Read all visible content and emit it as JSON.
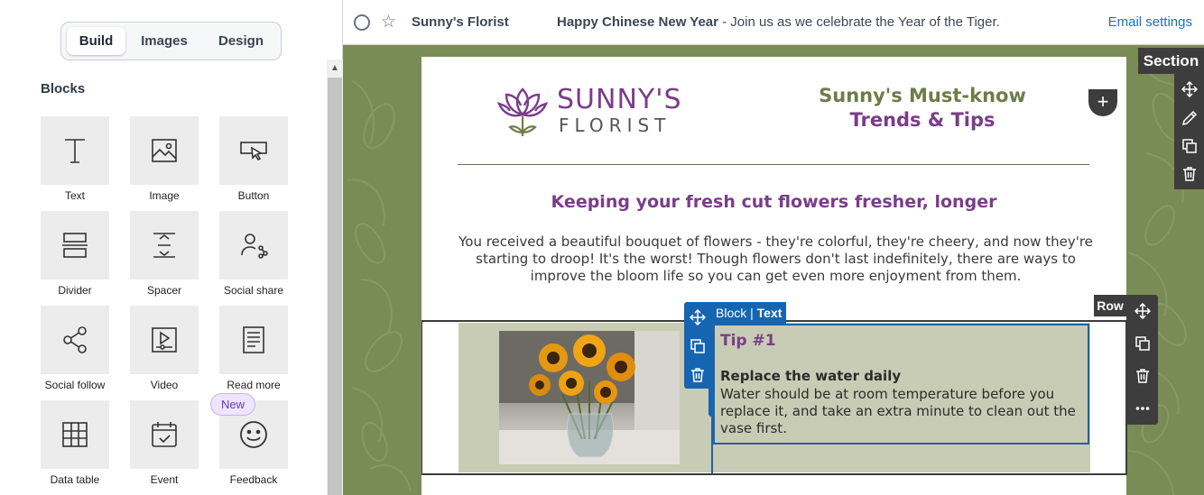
{
  "sidebar": {
    "tabs": [
      {
        "label": "Build",
        "active": true
      },
      {
        "label": "Images",
        "active": false
      },
      {
        "label": "Design",
        "active": false
      }
    ],
    "blocks_heading": "Blocks",
    "blocks": [
      {
        "label": "Text",
        "icon": "text-icon"
      },
      {
        "label": "Image",
        "icon": "image-icon"
      },
      {
        "label": "Button",
        "icon": "button-icon"
      },
      {
        "label": "Divider",
        "icon": "divider-icon"
      },
      {
        "label": "Spacer",
        "icon": "spacer-icon"
      },
      {
        "label": "Social share",
        "icon": "social-share-icon"
      },
      {
        "label": "Social follow",
        "icon": "social-follow-icon"
      },
      {
        "label": "Video",
        "icon": "video-icon"
      },
      {
        "label": "Read more",
        "icon": "read-more-icon"
      },
      {
        "label": "Data table",
        "icon": "data-table-icon"
      },
      {
        "label": "Event",
        "icon": "event-icon"
      },
      {
        "label": "Feedback",
        "icon": "feedback-icon"
      }
    ],
    "new_badge": "New"
  },
  "topbar": {
    "sender": "Sunny's Florist",
    "subject_bold": "Happy Chinese New Year",
    "subject_rest": " - Join us as we celebrate the Year of the Tiger.",
    "email_settings": "Email settings"
  },
  "email": {
    "logo_main": "SUNNY'S",
    "logo_sub": "FLORIST",
    "header_title_line1": "Sunny's Must-know",
    "header_title_line2": "Trends & Tips",
    "article_title": "Keeping your fresh cut flowers fresher, longer",
    "article_body": "You received a beautiful bouquet of flowers - they're colorful, they're cheery, and now they're starting to droop! It's the worst! Though flowers don't last indefinitely, there are ways to improve the bloom life so you can get even more enjoyment from them.",
    "tip_title": "Tip #1",
    "tip_heading": "Replace the water daily",
    "tip_text": "Water should be at room temperature before you replace it, and take an extra minute to clean out the vase first."
  },
  "editor": {
    "block_label": "Block",
    "block_type": "Text",
    "section_label": "Section",
    "row_label": "Row",
    "add_symbol": "+"
  },
  "colors": {
    "canvas_bg": "#7a8c55",
    "brand_purple": "#7a3d8a",
    "brand_olive": "#6e7c48",
    "selection_blue": "#1565b2",
    "tip_bg": "#c8ccb4",
    "link_blue": "#1a6fcb"
  }
}
